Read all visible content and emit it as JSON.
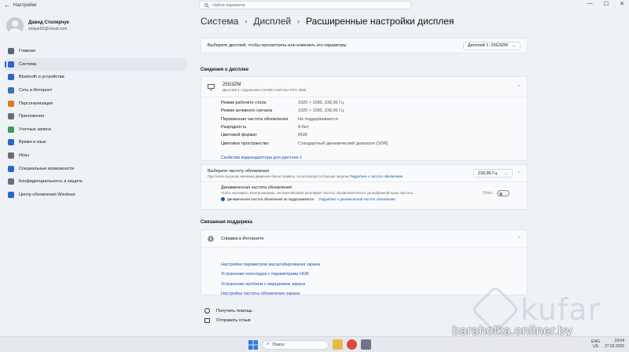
{
  "window": {
    "title": "Настройки",
    "back_icon": "back-arrow-icon",
    "controls": [
      "—",
      "☐",
      "✕"
    ]
  },
  "search": {
    "placeholder": "Найти параметр"
  },
  "profile": {
    "name": "Давид Столярчук",
    "email": "stolyar91@icloud.com"
  },
  "sidebar": {
    "items": [
      {
        "label": "Главная",
        "icon": "home-icon",
        "color": "#5b6472",
        "active": false
      },
      {
        "label": "Система",
        "icon": "system-icon",
        "color": "#2b66c9",
        "active": true
      },
      {
        "label": "Bluetooth и устройства",
        "icon": "bluetooth-icon",
        "color": "#2b66c9",
        "active": false
      },
      {
        "label": "Сеть и Интернет",
        "icon": "network-icon",
        "color": "#3d6fb8",
        "active": false
      },
      {
        "label": "Персонализация",
        "icon": "brush-icon",
        "color": "#d97a2a",
        "active": false
      },
      {
        "label": "Приложения",
        "icon": "apps-icon",
        "color": "#6a6f7a",
        "active": false
      },
      {
        "label": "Учетные записи",
        "icon": "account-icon",
        "color": "#3a9a5b",
        "active": false
      },
      {
        "label": "Время и язык",
        "icon": "globe-clock-icon",
        "color": "#2b66c9",
        "active": false
      },
      {
        "label": "Игры",
        "icon": "gamepad-icon",
        "color": "#6a6f7a",
        "active": false
      },
      {
        "label": "Специальные возможности",
        "icon": "accessibility-icon",
        "color": "#2b66c9",
        "active": false
      },
      {
        "label": "Конфиденциальность и защита",
        "icon": "shield-icon",
        "color": "#6a6f7a",
        "active": false
      },
      {
        "label": "Центр обновления Windows",
        "icon": "update-icon",
        "color": "#2b66c9",
        "active": false
      }
    ]
  },
  "breadcrumb": {
    "items": [
      "Система",
      "Дисплей",
      "Расширенные настройки дисплея"
    ]
  },
  "choose_display": {
    "label": "Выберите дисплей, чтобы просмотреть или изменить его параметры",
    "selected": "Дисплей 1: 25G3ZM"
  },
  "display_info": {
    "section_title": "Сведения о дисплее",
    "monitor_name": "25G3ZM",
    "monitor_sub": "Дисплей 1: подключен к NVIDIA GeForce RTX 3060",
    "rows": [
      {
        "k": "Режим рабочего стола",
        "v": "1920 × 1080, 239,96 Гц"
      },
      {
        "k": "Режим активного сигнала",
        "v": "1920 × 1080, 239,96 Гц"
      },
      {
        "k": "Переменная частота обновления",
        "v": "Не поддерживается"
      },
      {
        "k": "Разрядность",
        "v": "8-бит"
      },
      {
        "k": "Цветовой формат",
        "v": "RGB"
      },
      {
        "k": "Цветовое пространство",
        "v": "Стандартный динамический диапазон (SDR)"
      }
    ],
    "adapter_link": "Свойства видеоадаптера для дисплея 1"
  },
  "refresh": {
    "label": "Выберите частоту обновления",
    "sub": "При более высоком значении движение более плавное, но используется больше энергии",
    "sub_link": "Подробнее о частоте обновления",
    "value": "239,96 Гц"
  },
  "dynamic": {
    "label": "Динамическая частота обновления",
    "sub": "Чтобы экономить электроэнергию, система Windows регулирует частоту обновления вплоть до выбранной выше частоты.",
    "note": "Динамическая частота обновления не поддерживается",
    "note_link": "Подробнее о динамической частоте обновления",
    "toggle_label": "Откл."
  },
  "support": {
    "section_title": "Связанная поддержка",
    "help_label": "Справка в Интернете",
    "links": [
      "Настройка параметров масштабирования экрана",
      "Устранение неполадок с параметрами HDR",
      "Устранение проблем с мерцанием экрана",
      "Настройка частоты обновления экрана"
    ]
  },
  "bottom": {
    "help": "Получить помощь",
    "feedback": "Отправить отзыв"
  },
  "watermark": {
    "text": "kufar",
    "site": "baraholka.onliner.by"
  },
  "taskbar": {
    "search": "Поиск",
    "lang": "ENG",
    "region": "US",
    "time": "19:04",
    "date": "27.02.2026"
  }
}
